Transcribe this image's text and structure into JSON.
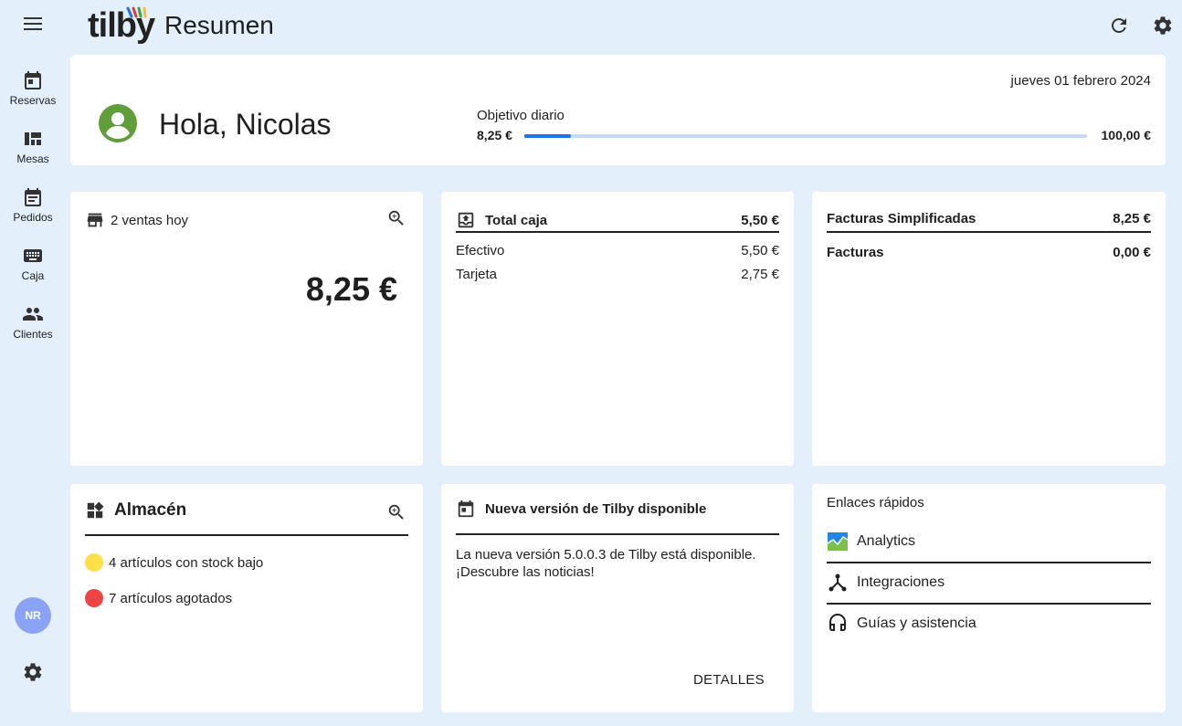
{
  "app": {
    "logo_text": "tilby",
    "page_title": "Resumen"
  },
  "sidebar": {
    "items": [
      {
        "label": "Reservas",
        "icon": "calendar-icon"
      },
      {
        "label": "Mesas",
        "icon": "tables-icon"
      },
      {
        "label": "Pedidos",
        "icon": "orders-icon"
      },
      {
        "label": "Caja",
        "icon": "keyboard-icon"
      },
      {
        "label": "Clientes",
        "icon": "people-icon"
      }
    ],
    "avatar_initials": "NR"
  },
  "welcome": {
    "greeting": "Hola, Nicolas",
    "date": "jueves 01 febrero 2024",
    "goal_label": "Objetivo diario",
    "goal_current": "8,25 €",
    "goal_target": "100,00 €",
    "goal_progress_fraction": 0.0825
  },
  "sales": {
    "title": "2 ventas hoy",
    "amount": "8,25 €"
  },
  "cash": {
    "title": "Total caja",
    "total": "5,50 €",
    "rows": [
      {
        "label": "Efectivo",
        "value": "5,50 €"
      },
      {
        "label": "Tarjeta",
        "value": "2,75 €"
      }
    ]
  },
  "invoices": {
    "rows": [
      {
        "label": "Facturas Simplificadas",
        "value": "8,25 €"
      },
      {
        "label": "Facturas",
        "value": "0,00 €"
      }
    ]
  },
  "warehouse": {
    "title": "Almacén",
    "items": [
      {
        "label": "4 artículos con stock bajo",
        "color": "#fde047"
      },
      {
        "label": "7 artículos agotados",
        "color": "#ef4444"
      }
    ]
  },
  "new_version": {
    "title": "Nueva versión de Tilby disponible",
    "text": "La nueva versión 5.0.0.3 de Tilby está disponible. ¡Descubre las noticias!",
    "button": "DETALLES"
  },
  "quick_links": {
    "title": "Enlaces rápidos",
    "items": [
      {
        "label": "Analytics",
        "icon": "analytics-icon"
      },
      {
        "label": "Integraciones",
        "icon": "integrations-icon"
      },
      {
        "label": "Guías y asistencia",
        "icon": "headset-icon"
      }
    ]
  },
  "colors": {
    "background": "#e3f0fb",
    "accent": "#1a73e8",
    "progress_track": "#c4d9f9",
    "avatar": "#8aa3f5",
    "user_icon": "#5f9e3a"
  }
}
